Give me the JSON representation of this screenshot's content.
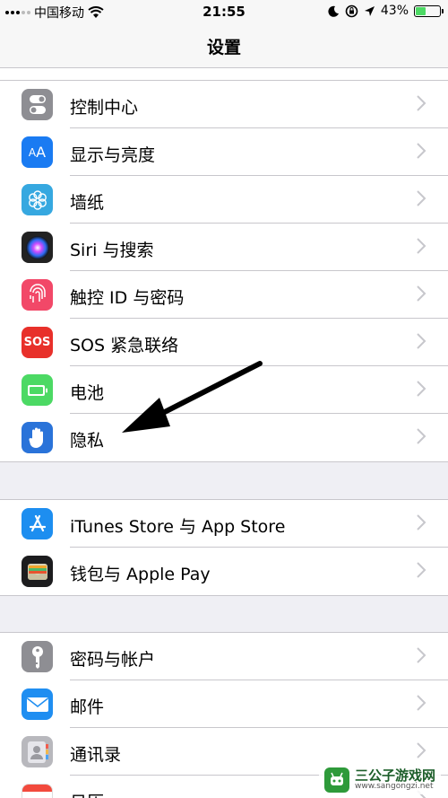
{
  "status_bar": {
    "carrier": "中国移动",
    "time": "21:55",
    "battery_percent": "43%",
    "battery_level": 0.43
  },
  "nav": {
    "title": "设置"
  },
  "groups": [
    {
      "items": [
        {
          "label": "控制中心",
          "icon": "control-center-icon",
          "color": "#8e8e93"
        },
        {
          "label": "显示与亮度",
          "icon": "display-brightness-icon",
          "color": "#1a7bf2"
        },
        {
          "label": "墙纸",
          "icon": "wallpaper-icon",
          "color": "#36a8e0"
        },
        {
          "label": "Siri 与搜索",
          "icon": "siri-icon",
          "color": "#222222"
        },
        {
          "label": "触控 ID 与密码",
          "icon": "touch-id-icon",
          "color": "#f24868"
        },
        {
          "label": "SOS 紧急联络",
          "icon": "sos-icon",
          "color": "#e8302a",
          "icon_text": "SOS"
        },
        {
          "label": "电池",
          "icon": "battery-icon",
          "color": "#4cd964"
        },
        {
          "label": "隐私",
          "icon": "privacy-hand-icon",
          "color": "#2a73d9"
        }
      ]
    },
    {
      "items": [
        {
          "label": "iTunes Store 与 App Store",
          "icon": "app-store-icon",
          "color": "#1d8ef0"
        },
        {
          "label": "钱包与 Apple Pay",
          "icon": "wallet-icon",
          "color": "#1c1c1e"
        }
      ]
    },
    {
      "items": [
        {
          "label": "密码与帐户",
          "icon": "key-icon",
          "color": "#8e8e93"
        },
        {
          "label": "邮件",
          "icon": "mail-icon",
          "color": "#1f8ef1"
        },
        {
          "label": "通讯录",
          "icon": "contacts-icon",
          "color": "#b8b8bd"
        },
        {
          "label": "日历",
          "icon": "calendar-icon",
          "color": "#ffffff"
        }
      ]
    }
  ],
  "watermark": {
    "title": "三公子游戏网",
    "url": "www.sangongzi.net"
  }
}
